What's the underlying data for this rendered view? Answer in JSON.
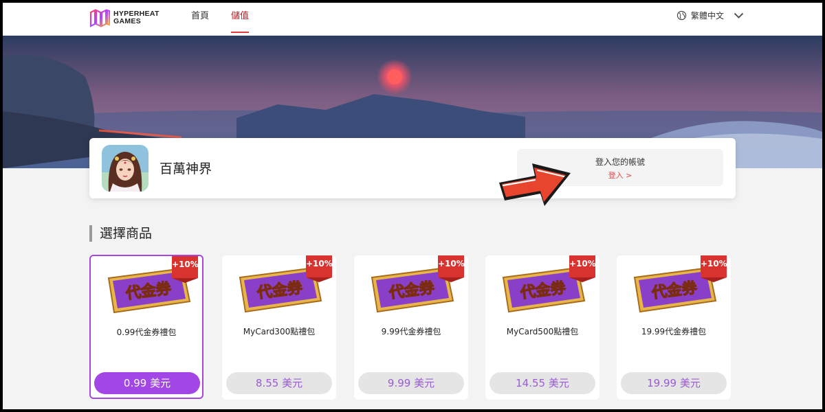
{
  "header": {
    "logo_line1": "HYPERHEAT",
    "logo_line2": "GAMES",
    "nav": [
      "首頁",
      "儲值"
    ],
    "active_nav": "儲值",
    "language": "繁體中文"
  },
  "game": {
    "title": "百萬神界"
  },
  "login": {
    "prompt": "登入您的帳號",
    "link": "登入 >"
  },
  "section": {
    "title": "選擇商品"
  },
  "products": [
    {
      "ticket_text": "代金券",
      "badge": "+10%",
      "name": "0.99代金券禮包",
      "price": "0.99 美元",
      "selected": true
    },
    {
      "ticket_text": "代金券",
      "badge": "+10%",
      "name": "MyCard300點禮包",
      "price": "8.55 美元",
      "selected": false
    },
    {
      "ticket_text": "代金券",
      "badge": "+10%",
      "name": "9.99代金券禮包",
      "price": "9.99 美元",
      "selected": false
    },
    {
      "ticket_text": "代金券",
      "badge": "+10%",
      "name": "MyCard500點禮包",
      "price": "14.55 美元",
      "selected": false
    },
    {
      "ticket_text": "代金券",
      "badge": "+10%",
      "name": "19.99代金券禮包",
      "price": "19.99 美元",
      "selected": false
    }
  ],
  "colors": {
    "accent_purple": "#a246e6",
    "badge_red": "#d9332f",
    "arrow_red": "#e8452f",
    "nav_active": "#b4232a"
  }
}
